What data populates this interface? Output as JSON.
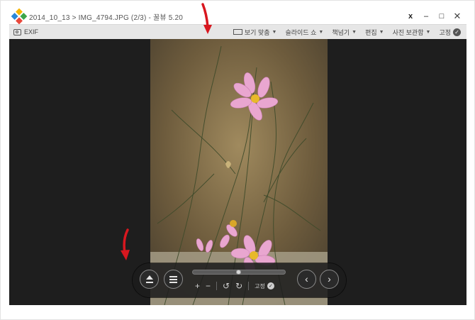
{
  "window": {
    "title": "2014_10_13 > IMG_4794.JPG (2/3) - 꿀뷰 5.20",
    "pin_label": "x",
    "minimize_label": "–",
    "maximize_label": "□",
    "close_label": "✕"
  },
  "toolbar": {
    "exif_label": "EXIF",
    "items": [
      {
        "label": "보기 맞춤",
        "icon": "fit-icon"
      },
      {
        "label": "슬라이드 쇼"
      },
      {
        "label": "책넘기"
      },
      {
        "label": "편집"
      },
      {
        "label": "사진 보관함"
      },
      {
        "label": "고정",
        "icon": "check-icon"
      }
    ]
  },
  "controls": {
    "slider_position": 0.49,
    "zoom_in_label": "+",
    "zoom_out_label": "−",
    "rotate_left_label": "↺",
    "rotate_right_label": "↻",
    "fix_label": "고정",
    "prev_label": "‹",
    "next_label": "›"
  },
  "colors": {
    "annotation_red": "#d8171f",
    "viewer_bg": "#1e1e1e",
    "toolbar_bg": "#e6e6e6"
  }
}
